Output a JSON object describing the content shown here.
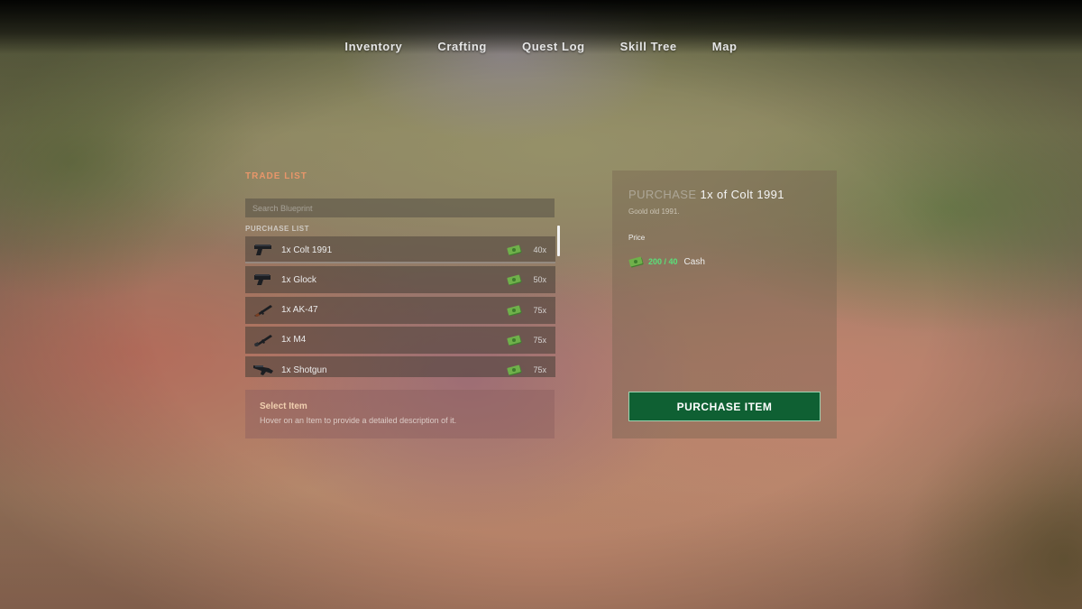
{
  "nav": {
    "items": [
      {
        "label": "Inventory"
      },
      {
        "label": "Crafting"
      },
      {
        "label": "Quest Log"
      },
      {
        "label": "Skill Tree"
      },
      {
        "label": "Map"
      }
    ]
  },
  "trade": {
    "title": "TRADE LIST",
    "search_placeholder": "Search Blueprint",
    "list_label": "PURCHASE LIST",
    "items": [
      {
        "name": "1x Colt 1991",
        "price": "40x",
        "icon": "pistol-icon",
        "selected": true
      },
      {
        "name": "1x Glock",
        "price": "50x",
        "icon": "pistol-icon",
        "selected": false
      },
      {
        "name": "1x AK-47",
        "price": "75x",
        "icon": "rifle-icon",
        "selected": false
      },
      {
        "name": "1x M4",
        "price": "75x",
        "icon": "rifle-icon",
        "selected": false
      },
      {
        "name": "1x Shotgun",
        "price": "75x",
        "icon": "shotgun-icon",
        "selected": false
      }
    ]
  },
  "description": {
    "title": "Select Item",
    "text": "Hover on an Item to provide a detailed description of it."
  },
  "detail": {
    "prefix": "PURCHASE",
    "item": "1x of Colt 1991",
    "subtitle": "Goold old 1991.",
    "price_label": "Price",
    "price_value": "200 / 40",
    "currency": "Cash",
    "button_label": "PURCHASE ITEM"
  },
  "colors": {
    "accent": "#e8966a",
    "button": "#0f6033",
    "price_ok": "#59e07a"
  }
}
